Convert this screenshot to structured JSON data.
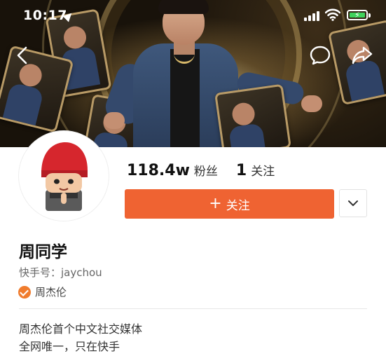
{
  "status_bar": {
    "time": "10:17"
  },
  "profile": {
    "followers_count": "118.4w",
    "followers_label": "粉丝",
    "following_count": "1",
    "following_label": "关注",
    "follow_button_label": "关注",
    "name": "周同学",
    "kuaishou_id": "快手号：jaychou",
    "verified_label": "周杰伦",
    "bio": [
      "周杰伦首个中文社交媒体",
      "全网唯一，只在快手"
    ]
  },
  "colors": {
    "accent": "#ef6332",
    "verified": "#f07c2e",
    "battery": "#3ed25b"
  },
  "icons": {
    "back": "back-arrow-icon",
    "chat": "chat-bubble-icon",
    "share": "share-icon",
    "dropdown": "chevron-down-icon",
    "verified": "verified-badge-icon"
  }
}
